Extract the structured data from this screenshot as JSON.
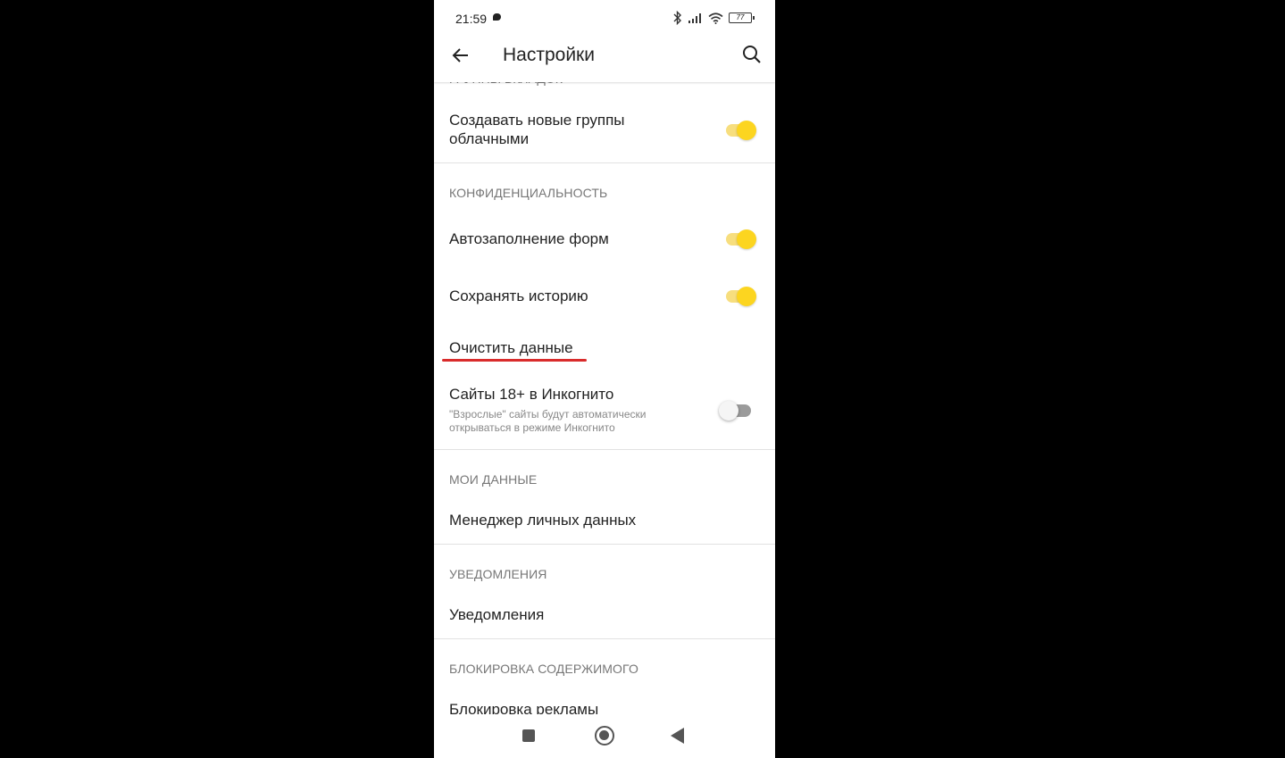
{
  "status": {
    "time": "21:59",
    "battery": "77"
  },
  "app_bar": {
    "title": "Настройки"
  },
  "settings": {
    "partial_header": "ГРУППЫ ВКЛАДОК",
    "cloud_groups": {
      "label_line1": "Создавать новые группы",
      "label_line2": "облачными",
      "enabled": true
    },
    "privacy_header": "КОНФИДЕНЦИАЛЬНОСТЬ",
    "autofill": {
      "label": "Автозаполнение форм",
      "enabled": true
    },
    "save_history": {
      "label": "Сохранять историю",
      "enabled": true
    },
    "clear_data": {
      "label": "Очистить данные"
    },
    "adult_incognito": {
      "label": "Сайты 18+ в Инкогнито",
      "desc_line1": "\"Взрослые\" сайты будут автоматически",
      "desc_line2": "открываться в режиме Инкогнито",
      "enabled": false
    },
    "my_data_header": "МОИ ДАННЫЕ",
    "personal_data_manager": {
      "label": "Менеджер личных данных"
    },
    "notifications_header": "УВЕДОМЛЕНИЯ",
    "notifications": {
      "label": "Уведомления"
    },
    "content_blocking_header": "БЛОКИРОВКА СОДЕРЖИМОГО",
    "ad_blocking": {
      "label": "Блокировка рекламы"
    }
  },
  "colors": {
    "toggle_on": "#fcd520",
    "highlight_underline": "#d92b2b"
  }
}
